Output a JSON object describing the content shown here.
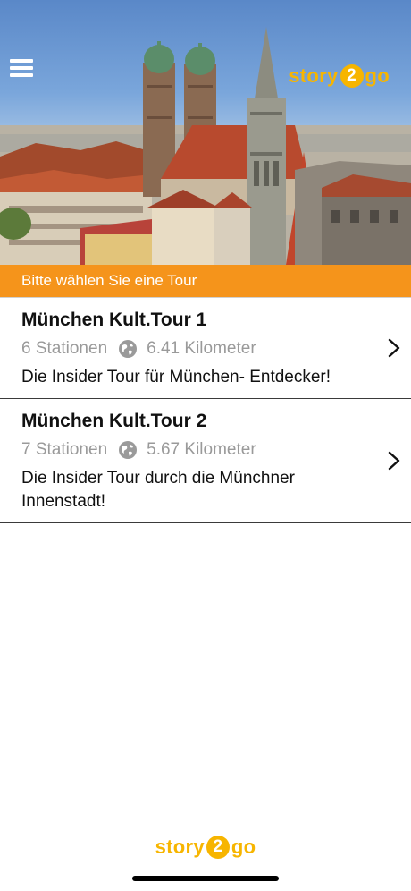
{
  "header": {
    "logo": {
      "before": "story",
      "digit": "2",
      "after": "go"
    },
    "menu_icon": "hamburger-menu-icon"
  },
  "prompt": "Bitte wählen Sie eine Tour",
  "tours": [
    {
      "title": "München Kult.Tour 1",
      "stations": "6 Stationen",
      "distance": "6.41 Kilometer",
      "description": "Die Insider Tour für München- Entdecker!"
    },
    {
      "title": "München Kult.Tour 2",
      "stations": "7 Stationen",
      "distance": "5.67 Kilometer",
      "description": "Die Insider Tour durch die Münchner Innenstadt!"
    }
  ],
  "footer": {
    "logo": {
      "before": "story",
      "digit": "2",
      "after": "go"
    }
  },
  "colors": {
    "accent_orange": "#f5941b",
    "logo_yellow": "#f7b500",
    "meta_gray": "#9a9a9a"
  }
}
